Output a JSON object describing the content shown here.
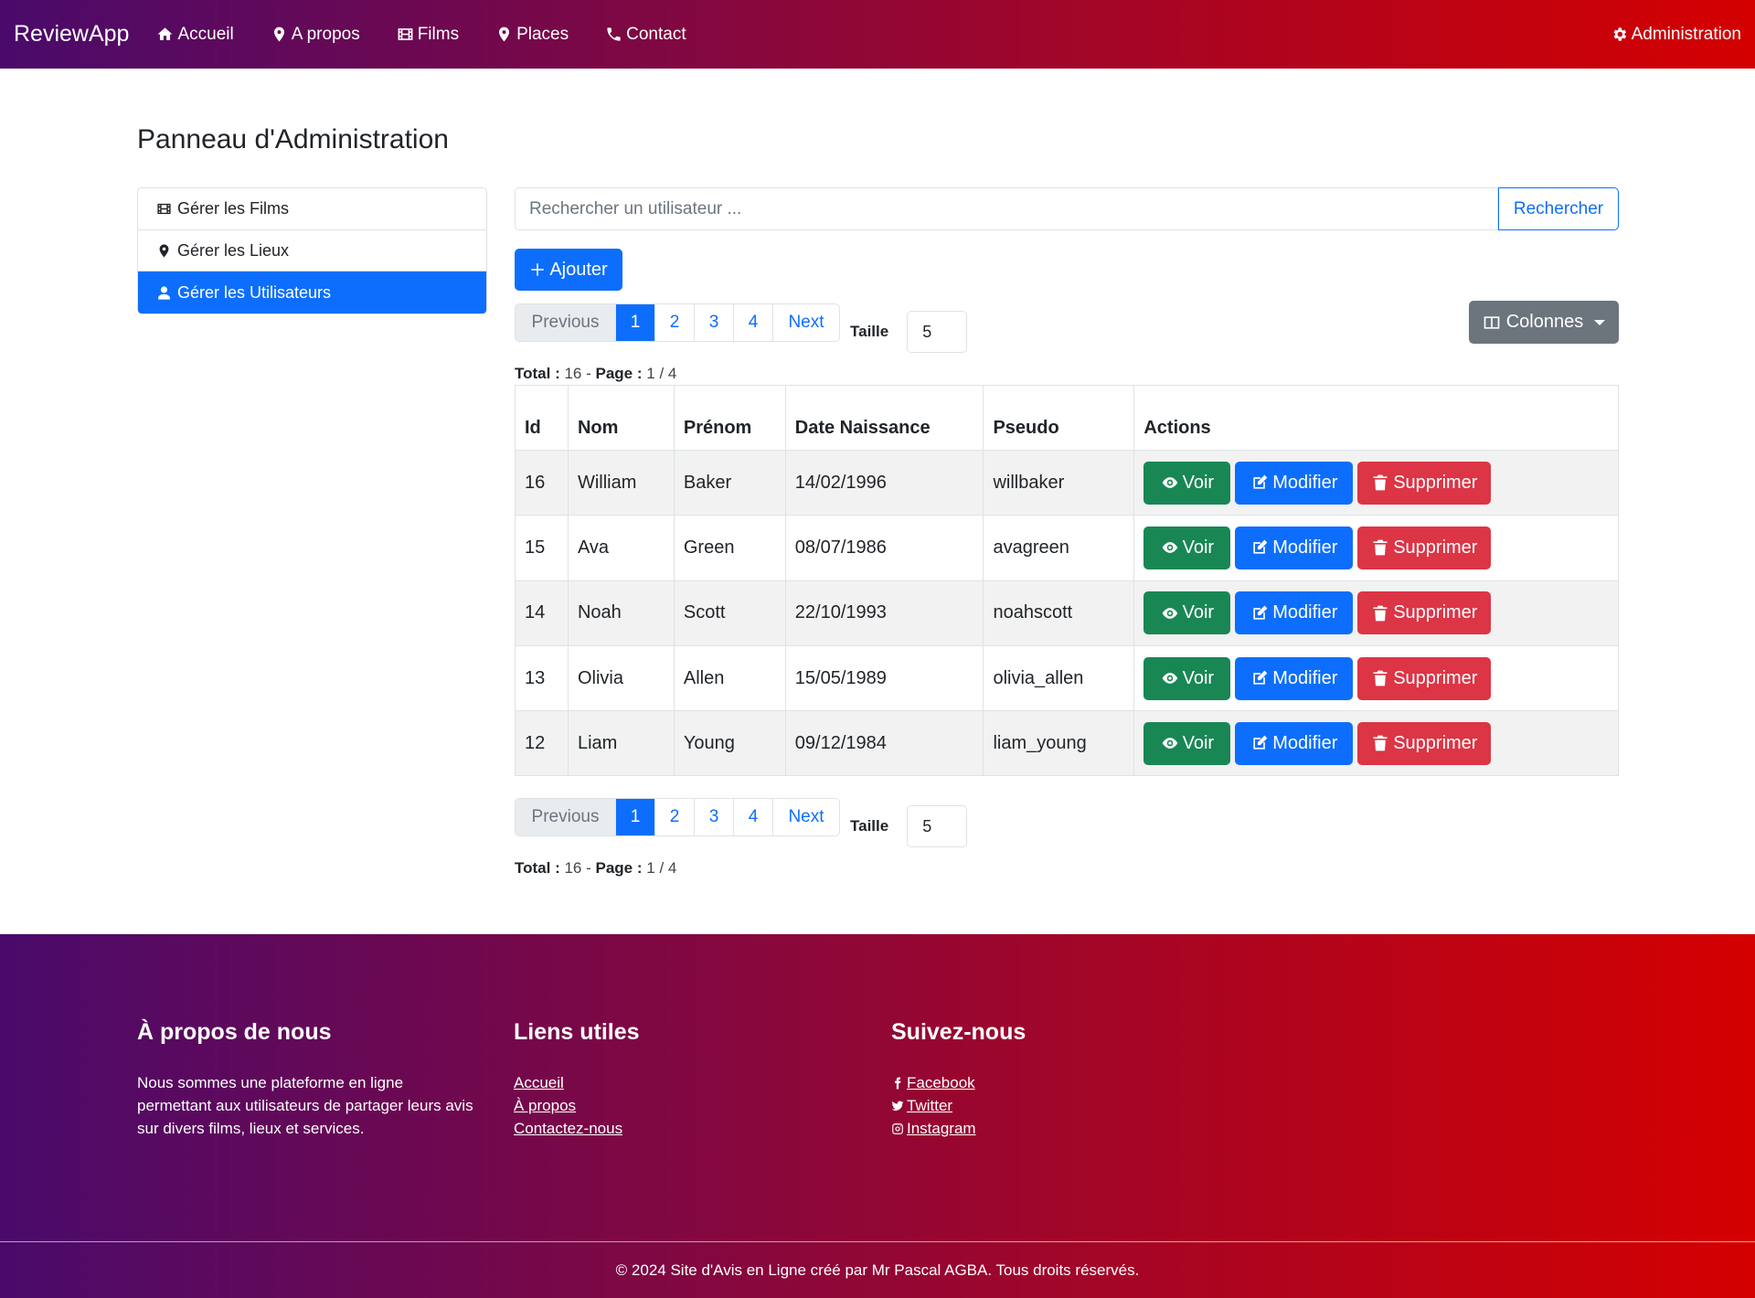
{
  "navbar": {
    "brand": "ReviewApp",
    "links": [
      "Accueil",
      "A propos",
      "Films",
      "Places",
      "Contact"
    ],
    "admin": "Administration"
  },
  "page": {
    "title": "Panneau d'Administration"
  },
  "sidebar": {
    "items": [
      {
        "label": "Gérer les Films",
        "icon": "film-icon"
      },
      {
        "label": "Gérer les Lieux",
        "icon": "map-marker-icon"
      },
      {
        "label": "Gérer les Utilisateurs",
        "icon": "user-icon",
        "active": true
      }
    ]
  },
  "search": {
    "placeholder": "Rechercher un utilisateur ...",
    "button": "Rechercher"
  },
  "add_button": "Ajouter",
  "columns_button": "Colonnes",
  "pagination": {
    "previous": "Previous",
    "pages": [
      "1",
      "2",
      "3",
      "4"
    ],
    "current": "1",
    "next": "Next",
    "size_label": "Taille",
    "size_value": "5"
  },
  "totals": {
    "total_label": "Total :",
    "total": "16",
    "page_label": "Page :",
    "page": "1 / 4"
  },
  "table": {
    "headers": [
      "Id",
      "Nom",
      "Prénom",
      "Date Naissance",
      "Pseudo",
      "Actions"
    ],
    "rows": [
      [
        "16",
        "William",
        "Baker",
        "14/02/1996",
        "willbaker"
      ],
      [
        "15",
        "Ava",
        "Green",
        "08/07/1986",
        "avagreen"
      ],
      [
        "14",
        "Noah",
        "Scott",
        "22/10/1993",
        "noahscott"
      ],
      [
        "13",
        "Olivia",
        "Allen",
        "15/05/1989",
        "olivia_allen"
      ],
      [
        "12",
        "Liam",
        "Young",
        "09/12/1984",
        "liam_young"
      ]
    ],
    "actions": {
      "view": "Voir",
      "edit": "Modifier",
      "delete": "Supprimer"
    }
  },
  "footer": {
    "about_title": "À propos de nous",
    "about_text": "Nous sommes une plateforme en ligne permettant aux utilisateurs de partager leurs avis sur divers films, lieux et services.",
    "links_title": "Liens utiles",
    "links": [
      "Accueil",
      "À propos",
      "Contactez-nous"
    ],
    "social_title": "Suivez-nous",
    "social": [
      " Facebook",
      " Twitter",
      " Instagram"
    ],
    "copyright": "© 2024 Site d'Avis en Ligne créé par Mr Pascal AGBA. Tous droits réservés."
  },
  "colors": {
    "primary": "#0d6efd",
    "success": "#198754",
    "danger": "#dc3545",
    "secondary": "#6c757d",
    "gradient_start": "#4a0a6b",
    "gradient_end": "#d40000"
  }
}
